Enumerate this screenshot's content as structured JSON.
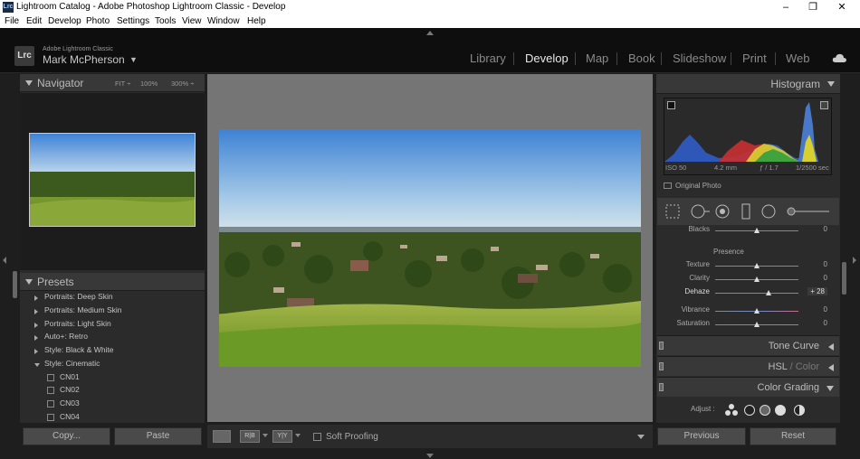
{
  "window": {
    "title": "Lightroom Catalog - Adobe Photoshop Lightroom Classic - Develop",
    "app_icon": "Lrc",
    "minimize": "–",
    "maximize": "❐",
    "close": "✕"
  },
  "menu": [
    "File",
    "Edit",
    "Develop",
    "Photo",
    "Settings",
    "Tools",
    "View",
    "Window",
    "Help"
  ],
  "identity": {
    "logo": "Lrc",
    "product": "Adobe Lightroom Classic",
    "user": "Mark McPherson",
    "caret": "▼"
  },
  "modules": [
    {
      "label": "Library",
      "active": false
    },
    {
      "label": "Develop",
      "active": true
    },
    {
      "label": "Map",
      "active": false
    },
    {
      "label": "Book",
      "active": false
    },
    {
      "label": "Slideshow",
      "active": false
    },
    {
      "label": "Print",
      "active": false
    },
    {
      "label": "Web",
      "active": false
    }
  ],
  "navigator": {
    "title": "Navigator",
    "fit": "FIT ÷",
    "zoom100": "100%",
    "zoom300": "300% ÷"
  },
  "presets": {
    "title": "Presets",
    "add": "+.",
    "items": [
      {
        "label": "Portraits: Deep Skin",
        "type": "group",
        "open": false
      },
      {
        "label": "Portraits: Medium Skin",
        "type": "group",
        "open": false
      },
      {
        "label": "Portraits: Light Skin",
        "type": "group",
        "open": false
      },
      {
        "label": "Auto+: Retro",
        "type": "group",
        "open": false
      },
      {
        "label": "Style: Black & White",
        "type": "group",
        "open": false
      },
      {
        "label": "Style: Cinematic",
        "type": "group",
        "open": true
      },
      {
        "label": "CN01",
        "type": "preset"
      },
      {
        "label": "CN02",
        "type": "preset"
      },
      {
        "label": "CN03",
        "type": "preset"
      },
      {
        "label": "CN04",
        "type": "preset"
      }
    ]
  },
  "left_buttons": {
    "copy": "Copy...",
    "paste": "Paste"
  },
  "toolbar": {
    "soft_proofing": "Soft Proofing",
    "compare_rb": "R|B",
    "compare_yy": "Y|Y"
  },
  "histogram": {
    "title": "Histogram",
    "iso": "ISO 50",
    "focal": "4.2 mm",
    "aperture": "ƒ / 1.7",
    "shutter": "1/2500 sec",
    "original_photo": "Original Photo"
  },
  "basic": {
    "blacks_label": "Blacks",
    "blacks_value": "0",
    "presence_label": "Presence",
    "sliders": [
      {
        "label": "Texture",
        "value": "0",
        "pos": 0.5
      },
      {
        "label": "Clarity",
        "value": "0",
        "pos": 0.5
      },
      {
        "label": "Dehaze",
        "value": "+ 28",
        "pos": 0.64
      },
      {
        "label": "Vibrance",
        "value": "0",
        "pos": 0.5
      },
      {
        "label": "Saturation",
        "value": "0",
        "pos": 0.5
      }
    ]
  },
  "sections": {
    "tone_curve": "Tone Curve",
    "hsl": "HSL",
    "hsl_sep": "/",
    "color": "Color",
    "color_grading": "Color Grading",
    "adjust": "Adjust :"
  },
  "right_buttons": {
    "previous": "Previous",
    "reset": "Reset"
  }
}
